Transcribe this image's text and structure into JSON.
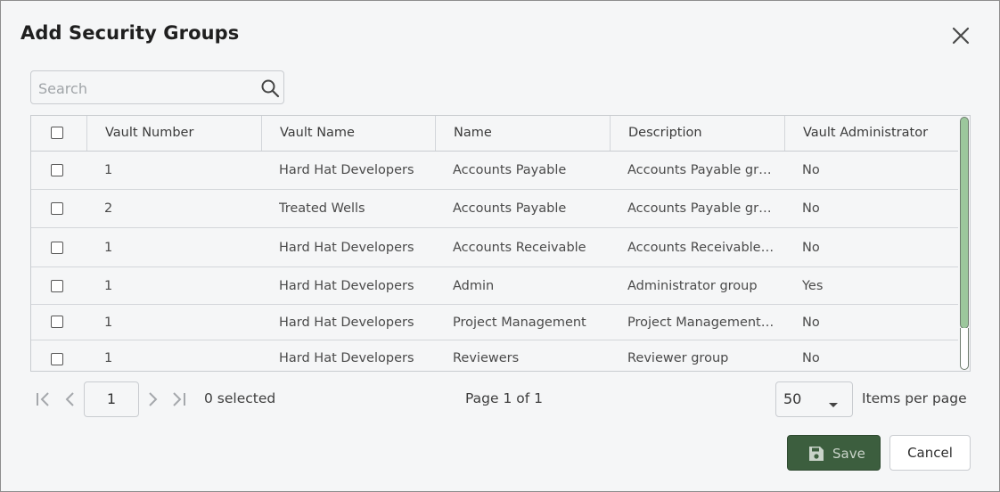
{
  "dialog": {
    "title": "Add Security Groups"
  },
  "search": {
    "placeholder": "Search",
    "value": ""
  },
  "table": {
    "columns": [
      "Vault Number",
      "Vault Name",
      "Name",
      "Description",
      "Vault Administrator"
    ],
    "rows": [
      [
        "1",
        "Hard Hat Developers",
        "Accounts Payable",
        "Accounts Payable gr…",
        "No"
      ],
      [
        "2",
        "Treated Wells",
        "Accounts Payable",
        "Accounts Payable gr…",
        "No"
      ],
      [
        "1",
        "Hard Hat Developers",
        "Accounts Receivable",
        "Accounts Receivable…",
        "No"
      ],
      [
        "1",
        "Hard Hat Developers",
        "Admin",
        "Administrator group",
        "Yes"
      ],
      [
        "1",
        "Hard Hat Developers",
        "Project Management",
        "Project Management…",
        "No"
      ],
      [
        "1",
        "Hard Hat Developers",
        "Reviewers",
        "Reviewer group",
        "No"
      ]
    ]
  },
  "pager": {
    "current_page": "1",
    "selected_text": "0 selected",
    "page_info": "Page 1 of 1",
    "items_per_page_value": "50",
    "items_per_page_label": "Items per page"
  },
  "actions": {
    "save_label": "Save",
    "cancel_label": "Cancel"
  },
  "colors": {
    "save_bg": "#3c5e3e",
    "scroll_thumb": "#9cc79c",
    "dialog_bg": "#f5f6f7"
  }
}
